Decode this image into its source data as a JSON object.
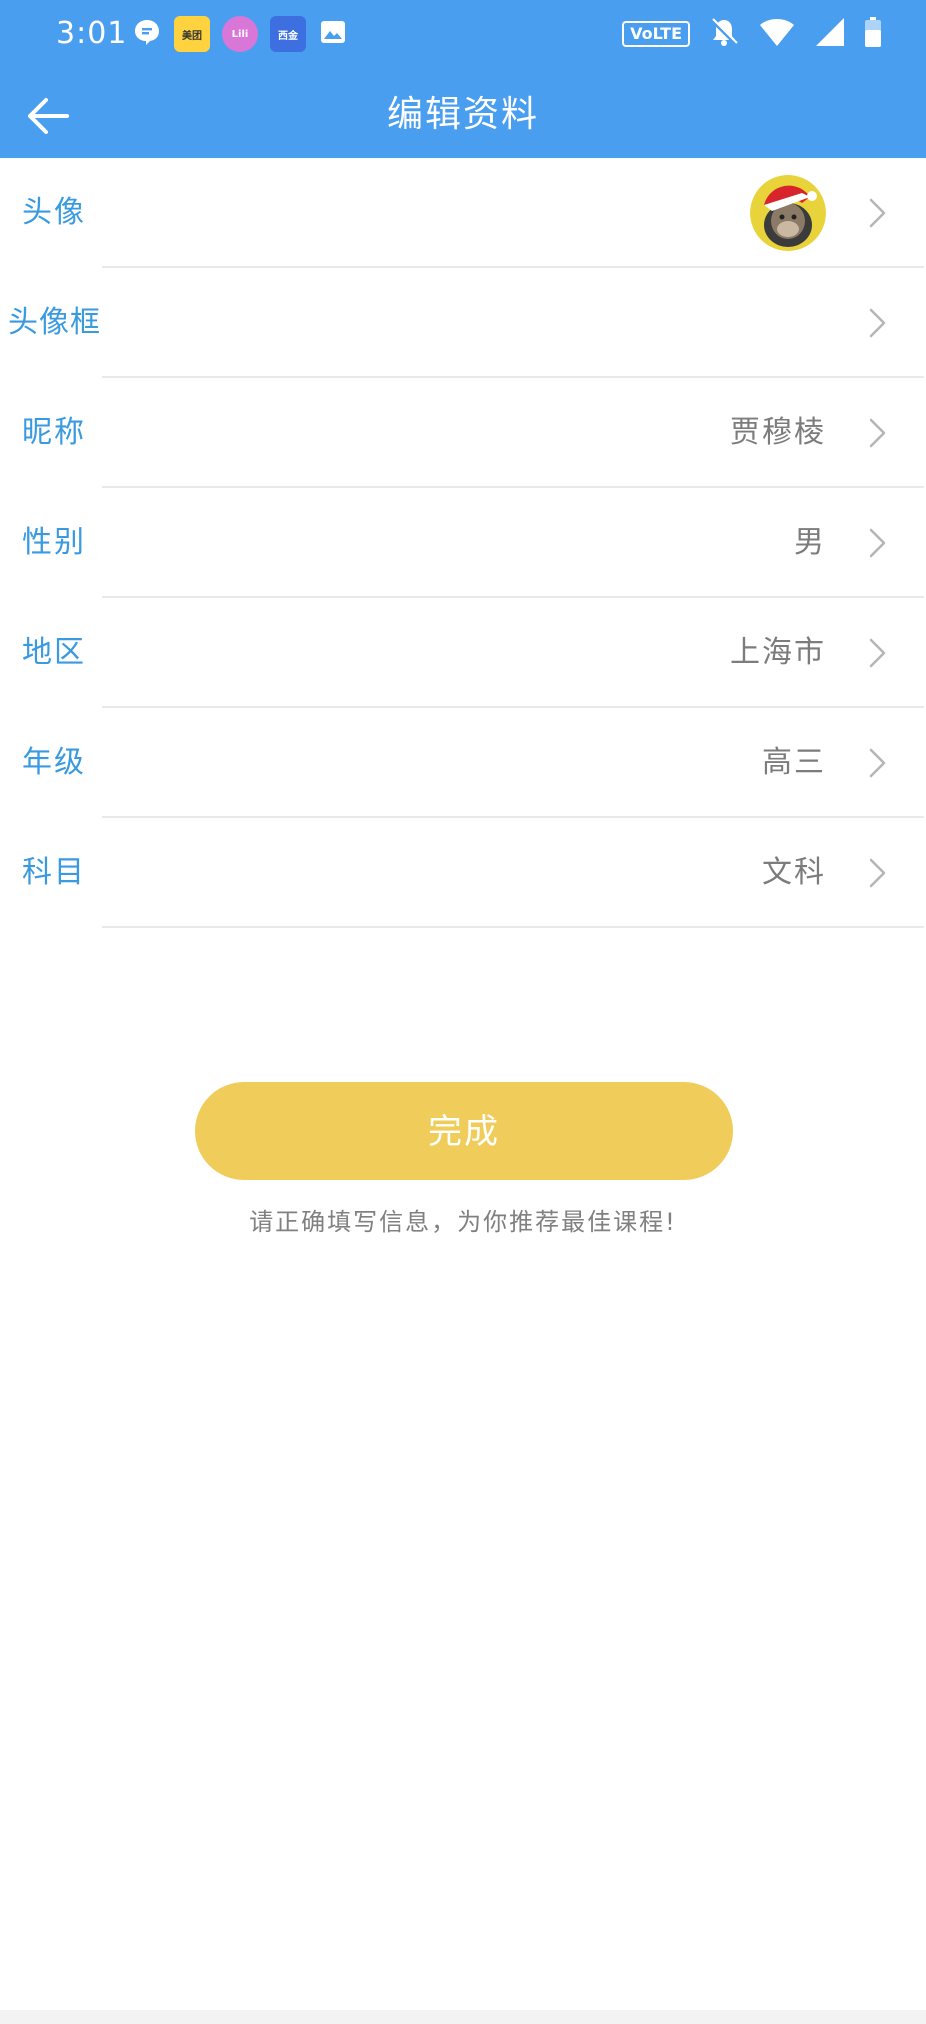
{
  "status_bar": {
    "time": "3:01",
    "network_badge": "VoLTE",
    "left_icons": [
      "message-icon",
      "meituan-app-icon",
      "lele-app-icon",
      "reading-app-icon",
      "image-icon"
    ],
    "right_icons": [
      "volte-icon",
      "bell-off-icon",
      "wifi-icon",
      "cell-signal-icon",
      "battery-icon"
    ],
    "app_badges": {
      "meituan": "美团",
      "lele": "Lili",
      "reading": "西金"
    }
  },
  "header": {
    "title": "编辑资料",
    "background": "#4a9ef0"
  },
  "profile": {
    "rows": [
      {
        "label": "头像",
        "value": ""
      },
      {
        "label": "头像框",
        "value": ""
      },
      {
        "label": "昵称",
        "value": "贾穆棱"
      },
      {
        "label": "性别",
        "value": "男"
      },
      {
        "label": "地区",
        "value": "上海市"
      },
      {
        "label": "年级",
        "value": "高三"
      },
      {
        "label": "科目",
        "value": "文科"
      }
    ]
  },
  "submit": {
    "label": "完成",
    "color": "#f0cd5a"
  },
  "hint": "请正确填写信息，为你推荐最佳课程!",
  "colors": {
    "label": "#3a9ae0",
    "value": "#7c7c7c",
    "divider": "#e9e9e9"
  }
}
